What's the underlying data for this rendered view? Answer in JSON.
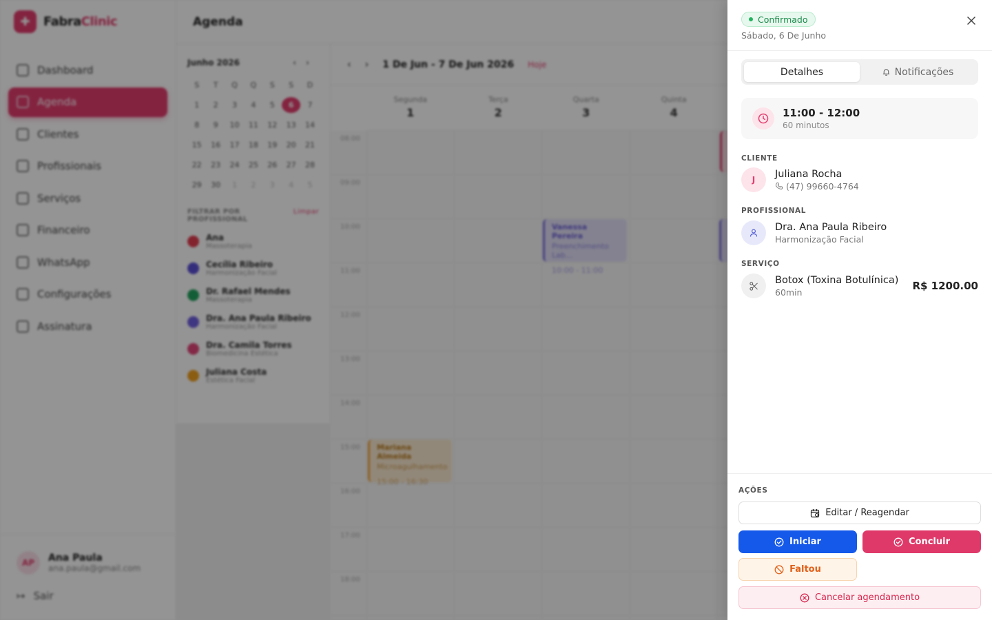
{
  "app": {
    "name_primary": "Fabra",
    "name_accent": "Clinic",
    "logo_icon": "plus-badge-icon"
  },
  "sidebar": {
    "items": [
      {
        "label": "Dashboard",
        "icon": "dashboard-icon"
      },
      {
        "label": "Agenda",
        "icon": "calendar-icon",
        "active": true
      },
      {
        "label": "Clientes",
        "icon": "users-icon"
      },
      {
        "label": "Profissionais",
        "icon": "professional-icon"
      },
      {
        "label": "Serviços",
        "icon": "scissors-icon"
      },
      {
        "label": "Financeiro",
        "icon": "chart-icon"
      },
      {
        "label": "WhatsApp",
        "icon": "chat-icon"
      },
      {
        "label": "Configurações",
        "icon": "gear-icon"
      },
      {
        "label": "Assinatura",
        "icon": "card-icon"
      }
    ],
    "user": {
      "initials": "AP",
      "name": "Ana Paula",
      "email": "ana.paula@gmail.com"
    },
    "logout_label": "Sair"
  },
  "page": {
    "title": "Agenda"
  },
  "mini_calendar": {
    "month_label": "Junho 2026",
    "weekdays": [
      "S",
      "T",
      "Q",
      "Q",
      "S",
      "S",
      "D"
    ],
    "selected_day": "6",
    "rows": [
      [
        "1",
        "2",
        "3",
        "4",
        "5",
        "6",
        "7"
      ],
      [
        "8",
        "9",
        "10",
        "11",
        "12",
        "13",
        "14"
      ],
      [
        "15",
        "16",
        "17",
        "18",
        "19",
        "20",
        "21"
      ],
      [
        "22",
        "23",
        "24",
        "25",
        "26",
        "27",
        "28"
      ],
      [
        "29",
        "30",
        "1",
        "2",
        "3",
        "4",
        "5"
      ]
    ]
  },
  "filter": {
    "heading": "FILTRAR POR PROFISSIONAL",
    "clear_label": "Limpar",
    "professionals": [
      {
        "name": "Ana",
        "role": "Massoterapia",
        "color": "#e23d4f"
      },
      {
        "name": "Cecília Ribeiro",
        "role": "Harmonização Facial",
        "color": "#5b4fd6"
      },
      {
        "name": "Dr. Rafael Mendes",
        "role": "Massoterapia",
        "color": "#22a35e"
      },
      {
        "name": "Dra. Ana Paula Ribeiro",
        "role": "Harmonização Facial",
        "color": "#6f5fe0"
      },
      {
        "name": "Dra. Camila Torres",
        "role": "Biomedicina Estética",
        "color": "#e2477a"
      },
      {
        "name": "Juliana Costa",
        "role": "Estética Facial",
        "color": "#f0a020"
      }
    ]
  },
  "week": {
    "range_label": "1 De Jun - 7 De Jun 2026",
    "today_label": "Hoje",
    "days": [
      {
        "name": "Segunda",
        "date": "1"
      },
      {
        "name": "Terça",
        "date": "2"
      },
      {
        "name": "Quarta",
        "date": "3"
      },
      {
        "name": "Quinta",
        "date": "4"
      }
    ],
    "hours": [
      "08:00",
      "09:00",
      "10:00",
      "11:00",
      "12:00",
      "13:00",
      "14:00",
      "15:00",
      "16:00",
      "17:00",
      "18:00"
    ],
    "events": [
      {
        "title": "Vanessa Pereira",
        "service": "Preenchimento Lab...",
        "time": "10:00 - 11:00"
      },
      {
        "title": "Mariana Almeida",
        "service": "Microagulhamento",
        "time": "15:00 - 16:30"
      }
    ]
  },
  "drawer": {
    "status": "Confirmado",
    "date": "Sábado, 6 De Junho",
    "tabs": {
      "details": "Detalhes",
      "notifications": "Notificações"
    },
    "time_range": "11:00 - 12:00",
    "duration": "60 minutos",
    "client": {
      "section": "CLIENTE",
      "initial": "J",
      "name": "Juliana Rocha",
      "phone": "(47) 99660-4764"
    },
    "professional": {
      "section": "PROFISSIONAL",
      "name": "Dra. Ana Paula Ribeiro",
      "specialty": "Harmonização Facial"
    },
    "service": {
      "section": "SERVIÇO",
      "name": "Botox (Toxina Botulínica)",
      "duration": "60min",
      "price": "R$ 1200.00"
    },
    "actions": {
      "section": "AÇÕES",
      "edit": "Editar / Reagendar",
      "start": "Iniciar",
      "finish": "Concluir",
      "no_show": "Faltou",
      "cancel": "Cancelar agendamento"
    }
  },
  "colors": {
    "brand": "#e23d6f",
    "start_button": "#1559ea",
    "finish_button": "#df3969",
    "success": "#22b35e"
  }
}
